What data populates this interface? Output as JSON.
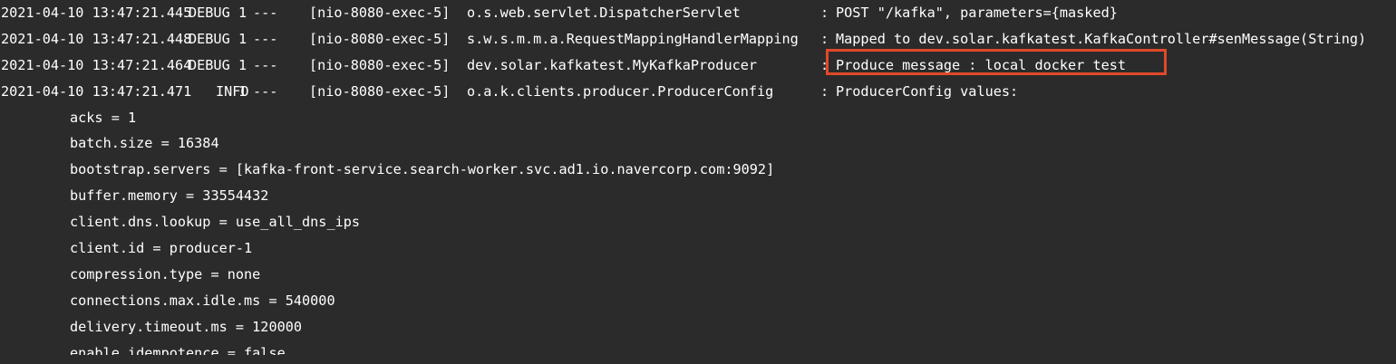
{
  "log_lines": [
    {
      "timestamp": "2021-04-10 13:47:21.445",
      "level": "DEBUG",
      "pid": "1",
      "separator": "---",
      "thread": "[nio-8080-exec-5]",
      "logger": "o.s.web.servlet.DispatcherServlet",
      "colon": ":",
      "message": "POST \"/kafka\", parameters={masked}"
    },
    {
      "timestamp": "2021-04-10 13:47:21.448",
      "level": "DEBUG",
      "pid": "1",
      "separator": "---",
      "thread": "[nio-8080-exec-5]",
      "logger": "s.w.s.m.m.a.RequestMappingHandlerMapping",
      "colon": ":",
      "message": "Mapped to dev.solar.kafkatest.KafkaController#senMessage(String)"
    },
    {
      "timestamp": "2021-04-10 13:47:21.464",
      "level": "DEBUG",
      "pid": "1",
      "separator": "---",
      "thread": "[nio-8080-exec-5]",
      "logger": "dev.solar.kafkatest.MyKafkaProducer",
      "colon": ":",
      "message": "Produce message : local docker test"
    },
    {
      "timestamp": "2021-04-10 13:47:21.471",
      "level": "INFO",
      "pid": "1",
      "separator": "---",
      "thread": "[nio-8080-exec-5]",
      "logger": "o.a.k.clients.producer.ProducerConfig",
      "colon": ":",
      "message": "ProducerConfig values:"
    }
  ],
  "config_lines": [
    "acks = 1",
    "batch.size = 16384",
    "bootstrap.servers = [kafka-front-service.search-worker.svc.ad1.io.navercorp.com:9092]",
    "buffer.memory = 33554432",
    "client.dns.lookup = use_all_dns_ips",
    "client.id = producer-1",
    "compression.type = none",
    "connections.max.idle.ms = 540000",
    "delivery.timeout.ms = 120000",
    "enable.idempotence = false"
  ],
  "colors": {
    "background": "#2b2b2b",
    "text": "#ffffff",
    "highlight_border": "#e0492a"
  }
}
